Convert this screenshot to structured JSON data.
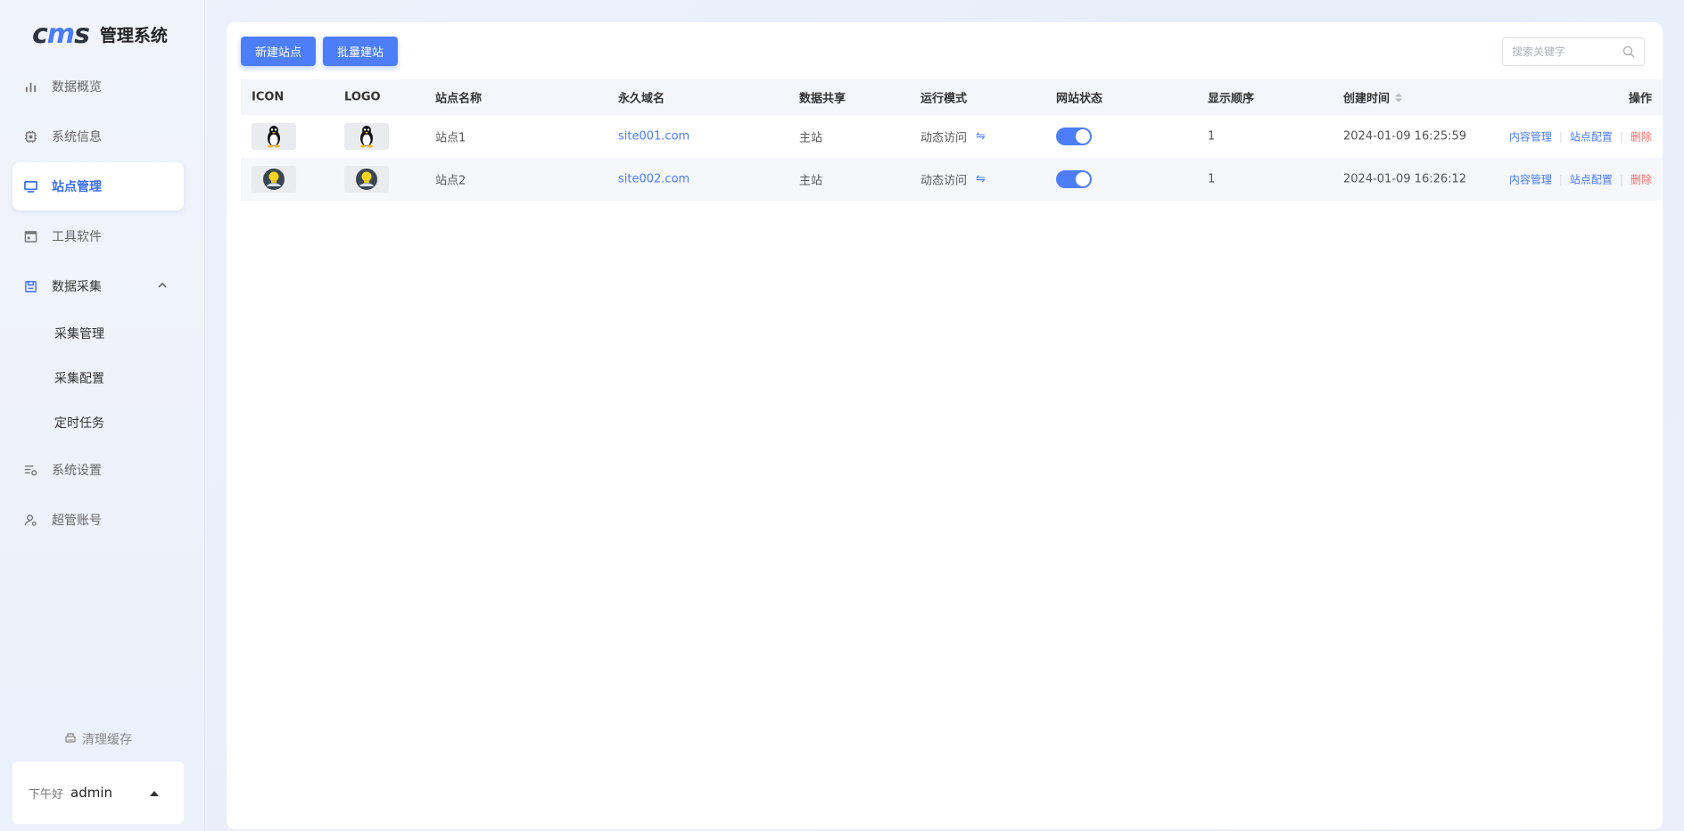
{
  "app": {
    "logo_text_1": "c",
    "logo_text_2": "m",
    "logo_text_3": "s",
    "title": "管理系统"
  },
  "sidebar": {
    "items": [
      {
        "label": "数据概览",
        "icon": "bar-chart-icon"
      },
      {
        "label": "系统信息",
        "icon": "chip-icon"
      },
      {
        "label": "站点管理",
        "icon": "monitor-icon"
      },
      {
        "label": "工具软件",
        "icon": "window-icon"
      },
      {
        "label": "数据采集",
        "icon": "save-icon"
      },
      {
        "label": "系统设置",
        "icon": "settings-list-icon"
      },
      {
        "label": "超管账号",
        "icon": "user-gear-icon"
      }
    ],
    "sub_items": [
      "采集管理",
      "采集配置",
      "定时任务"
    ],
    "clear_cache": "清理缓存",
    "user": {
      "greeting": "下午好",
      "name": "admin"
    }
  },
  "toolbar": {
    "new_site": "新建站点",
    "batch_site": "批量建站",
    "search_placeholder": "搜索关键字"
  },
  "table": {
    "headers": {
      "icon": "ICON",
      "logo": "LOGO",
      "name": "站点名称",
      "domain": "永久域名",
      "share": "数据共享",
      "mode": "运行模式",
      "status": "网站状态",
      "order": "显示顺序",
      "time": "创建时间",
      "ops": "操作"
    },
    "rows": [
      {
        "name": "站点1",
        "domain": "site001.com",
        "share": "主站",
        "mode": "动态访问",
        "status": true,
        "order": "1",
        "time": "2024-01-09 16:25:59",
        "icon": "penguin-icon"
      },
      {
        "name": "站点2",
        "domain": "site002.com",
        "share": "主站",
        "mode": "动态访问",
        "status": true,
        "order": "1",
        "time": "2024-01-09 16:26:12",
        "icon": "avatar-icon"
      }
    ],
    "ops": {
      "content": "内容管理",
      "config": "站点配置",
      "delete": "删除"
    }
  },
  "colors": {
    "accent": "#4d7ef7",
    "danger": "#f56c6c"
  }
}
